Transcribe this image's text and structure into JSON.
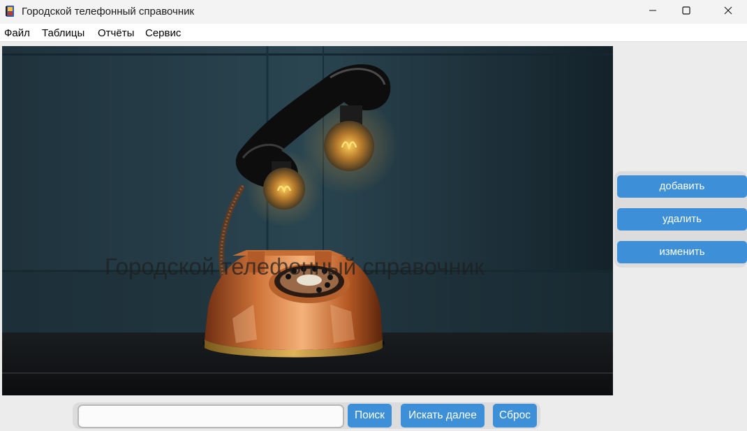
{
  "window": {
    "title": "Городской телефонный справочник",
    "icons": {
      "app": "phone-book-icon",
      "minimize": "minimize-icon",
      "maximize": "maximize-icon",
      "close": "close-icon"
    }
  },
  "menu": {
    "items": [
      "Файл",
      "Таблицы",
      "Отчёты",
      "Сервис"
    ]
  },
  "main": {
    "overlay_title": "Городской телефонный справочник"
  },
  "side_actions": {
    "add_label": "добавить",
    "delete_label": "удалить",
    "edit_label": "изменить"
  },
  "search": {
    "value": "",
    "placeholder": "",
    "search_label": "Поиск",
    "next_label": "Искать далее",
    "reset_label": "Сброс"
  },
  "colors": {
    "accent": "#3d8fd8",
    "panel": "#dcdcdc"
  }
}
